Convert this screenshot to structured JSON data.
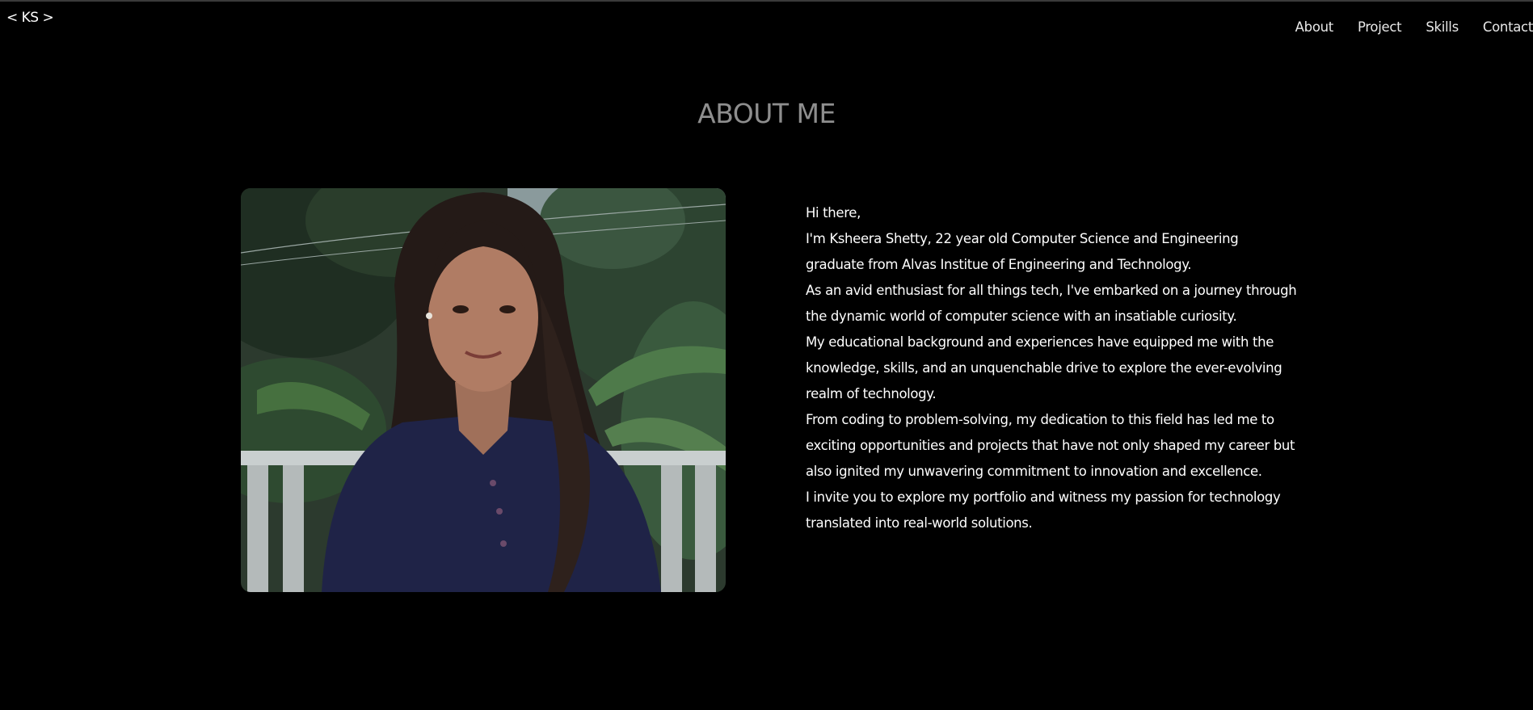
{
  "header": {
    "logo": "< KS >",
    "nav": [
      {
        "label": "About"
      },
      {
        "label": "Project"
      },
      {
        "label": "Skills"
      },
      {
        "label": "Contact"
      }
    ]
  },
  "about": {
    "title": "ABOUT ME",
    "photo_alt": "portrait photo",
    "paragraphs": [
      "Hi there,",
      "I'm Ksheera Shetty, 22 year old Computer Science and Engineering graduate from Alvas Institue of Engineering and Technology.",
      "As an avid enthusiast for all things tech, I've embarked on a journey through the dynamic world of computer science with an insatiable curiosity.",
      "My educational background and experiences have equipped me with the knowledge, skills, and an unquenchable drive to explore the ever-evolving realm of technology.",
      "From coding to problem-solving, my dedication to this field has led me to exciting opportunities and projects that have not only shaped my career but also ignited my unwavering commitment to innovation and excellence.",
      "I invite you to explore my portfolio and witness my passion for technology translated into real-world solutions."
    ]
  },
  "colors": {
    "background": "#000000",
    "title": "#8e8e8e",
    "text": "#ffffff"
  }
}
